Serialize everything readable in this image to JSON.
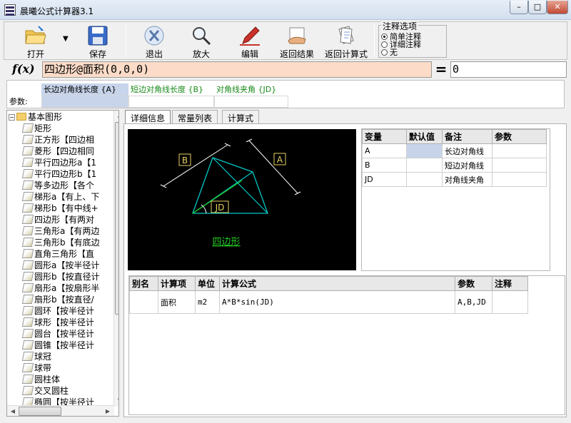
{
  "app": {
    "title": "晨曦公式计算器3.1"
  },
  "window_controls": {
    "minimize": "–",
    "maximize": "□",
    "close": "✕"
  },
  "toolbar": {
    "open": "打开",
    "save": "保存",
    "exit": "退出",
    "zoom": "放大",
    "edit": "编辑",
    "back_result": "返回结果",
    "back_formula": "返回计算式",
    "note_options": {
      "title": "注释选项",
      "opt1": "简单注释",
      "opt2": "详细注释",
      "opt3": "无",
      "selected": "简单注释"
    }
  },
  "formula": {
    "label": "f(x)",
    "value": "四边形@面积(0,0,0)",
    "equals": "=",
    "result": "0"
  },
  "params": {
    "label": "参数:",
    "columns": [
      "长边对角线长度 {A}",
      "短边对角线长度 {B}",
      "对角线夹角 {JD}"
    ],
    "column_colors": [
      "#000000",
      "#1a8a1a",
      "#1a8a1a"
    ]
  },
  "tree": {
    "root": "基本图形",
    "items": [
      "矩形",
      "正方形【四边相",
      "菱形【四边相同",
      "平行四边形a【1",
      "平行四边形b【1",
      "等多边形【各个",
      "梯形a【有上、下",
      "梯形b【有中线+",
      "四边形【有两对",
      "三角形a【有两边",
      "三角形b【有底边",
      "直角三角形【直",
      "圆形a【按半径计",
      "圆形b【按直径计",
      "扇形a【按扇形半",
      "扇形b【按直径/",
      "圆环【按半径计",
      "球形【按半径计",
      "圆台【按半径计",
      "圆锥【按半径计",
      "球冠",
      "球带",
      "圆柱体",
      "交叉圆柱",
      "椭圆【按半径计"
    ]
  },
  "tabs": [
    "详细信息",
    "常量列表",
    "计算式"
  ],
  "diagram": {
    "caption": "四边形",
    "label_a": "A",
    "label_b": "B",
    "label_jd": "JD",
    "line_color": "#00c8c8",
    "caption_color": "#22cc22"
  },
  "variables": {
    "headers": [
      "变量",
      "默认值",
      "备注",
      "参数"
    ],
    "rows": [
      {
        "var": "A",
        "default": "",
        "note": "长边对角线",
        "param": ""
      },
      {
        "var": "B",
        "default": "",
        "note": "短边对角线",
        "param": ""
      },
      {
        "var": "JD",
        "default": "",
        "note": "对角线夹角",
        "param": ""
      }
    ]
  },
  "calc": {
    "headers": [
      "别名",
      "计算项",
      "单位",
      "计算公式",
      "参数",
      "注释"
    ],
    "rows": [
      {
        "alias": "",
        "item": "面积",
        "unit": "m2",
        "formula": "A*B*sin(JD)",
        "params": "A,B,JD",
        "note": ""
      }
    ]
  }
}
